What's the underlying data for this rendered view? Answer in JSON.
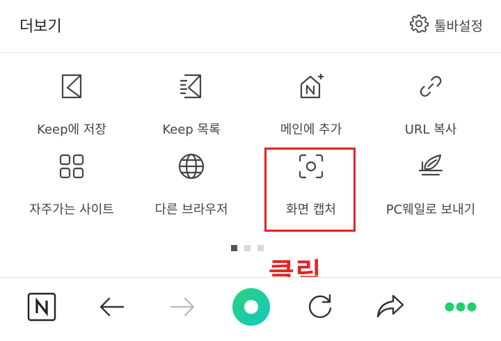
{
  "header": {
    "title": "더보기",
    "settings_label": "툴바설정"
  },
  "menu": [
    {
      "label": "Keep에 저장",
      "icon": "keep-save-icon"
    },
    {
      "label": "Keep 목록",
      "icon": "keep-list-icon"
    },
    {
      "label": "메인에 추가",
      "icon": "add-to-main-icon"
    },
    {
      "label": "URL 복사",
      "icon": "link-copy-icon"
    },
    {
      "label": "자주가는 사이트",
      "icon": "frequent-sites-icon"
    },
    {
      "label": "다른 브라우저",
      "icon": "globe-icon"
    },
    {
      "label": "화면 캡처",
      "icon": "screen-capture-icon"
    },
    {
      "label": "PC웨일로 보내기",
      "icon": "send-to-pc-icon"
    }
  ],
  "pagination": {
    "count": 3,
    "active": 0
  },
  "annotation": {
    "text": "클릭",
    "color": "#e52222"
  },
  "toolbar": {
    "items": [
      "naver-home-icon",
      "back-arrow-icon",
      "forward-arrow-icon",
      "green-dot-icon",
      "refresh-icon",
      "share-icon",
      "more-dots-icon"
    ]
  },
  "colors": {
    "accent_green": "#1fcf6a",
    "highlight_red": "#e52222",
    "icon_gray": "#444444"
  }
}
